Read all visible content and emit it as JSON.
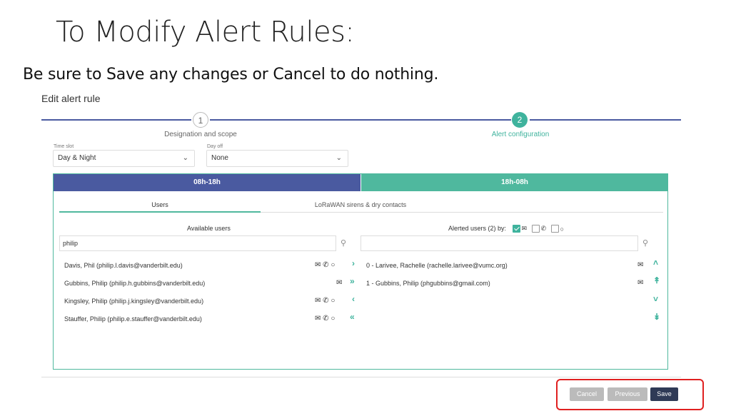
{
  "slide": {
    "title": "To Modify Alert Rules:",
    "subtitle": "Be sure to Save any changes or Cancel to do nothing."
  },
  "panel": {
    "title": "Edit alert rule"
  },
  "stepper": {
    "steps": [
      {
        "number": "1",
        "label": "Designation and scope"
      },
      {
        "number": "2",
        "label": "Alert configuration"
      }
    ]
  },
  "fields": {
    "time_slot": {
      "label": "Time slot",
      "value": "Day & Night"
    },
    "day_off": {
      "label": "Day off",
      "value": "None"
    }
  },
  "time_tabs": [
    "08h-18h",
    "18h-08h"
  ],
  "sub_tabs": [
    "Users",
    "LoRaWAN sirens & dry contacts"
  ],
  "available": {
    "heading": "Available users",
    "search_value": "philip",
    "users": [
      "Davis, Phil (philip.l.davis@vanderbilt.edu)",
      "Gubbins, Philip (philip.h.gubbins@vanderbilt.edu)",
      "Kingsley, Philip (philip.j.kingsley@vanderbilt.edu)",
      "Stauffer, Philip (philip.e.stauffer@vanderbilt.edu)"
    ]
  },
  "alerted": {
    "heading": "Alerted users (2) by:",
    "search_value": "",
    "users": [
      "0 - Larivee, Rachelle (rachelle.larivee@vumc.org)",
      "1 - Gubbins, Philip (phgubbins@gmail.com)"
    ]
  },
  "buttons": {
    "cancel": "Cancel",
    "previous": "Previous",
    "save": "Save"
  },
  "colors": {
    "navy": "#4a5aa0",
    "teal": "#4fb89e",
    "save": "#2f3a56",
    "highlight": "#e02020"
  }
}
